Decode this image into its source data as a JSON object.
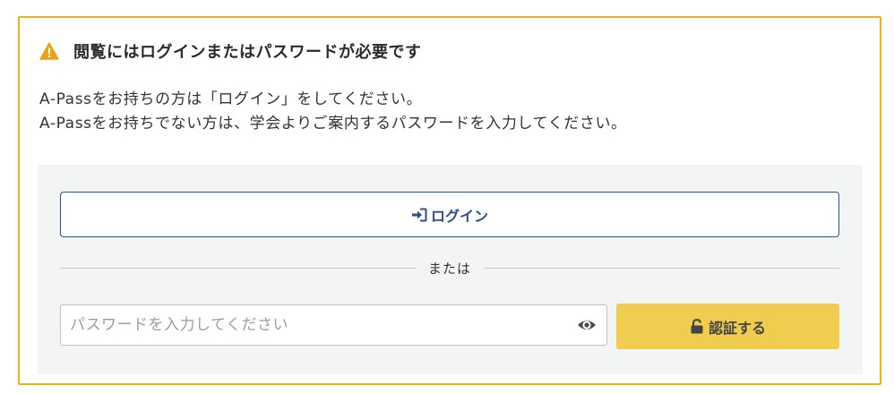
{
  "warning": {
    "icon": "warning-triangle-icon",
    "title": "閲覧にはログインまたはパスワードが必要です",
    "accent_color": "#e8b321"
  },
  "intro": {
    "line1": "A-Passをお持ちの方は「ログイン」をしてください。",
    "line2": "A-Passをお持ちでない方は、学会よりご案内するパスワードを入力してください。"
  },
  "login": {
    "label": "ログイン",
    "icon": "sign-in-icon",
    "color": "#2b4f8a"
  },
  "divider": {
    "label": "または"
  },
  "password": {
    "placeholder": "パスワードを入力してください",
    "value": "",
    "toggle_icon": "eye-icon"
  },
  "auth": {
    "label": "認証する",
    "icon": "unlock-icon",
    "color": "#f0cd4e"
  }
}
